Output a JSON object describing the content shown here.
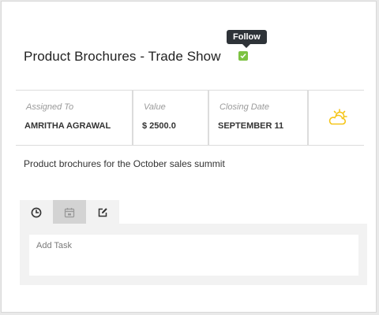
{
  "deal": {
    "title": "Product Brochures - Trade Show",
    "follow_tooltip": "Follow",
    "description": "Product brochures for the October sales summit"
  },
  "stats": {
    "assigned_label": "Assigned To",
    "assigned_value": "AMRITHA AGRAWAL",
    "value_label": "Value",
    "value_value": "$ 2500.0",
    "closing_label": "Closing Date",
    "closing_value": "SEPTEMBER 11",
    "weather_icon": "partly-cloudy-sun-icon"
  },
  "tabs": [
    {
      "icon": "clock-icon",
      "active": false
    },
    {
      "icon": "calendar-icon",
      "active": true
    },
    {
      "icon": "edit-icon",
      "active": false
    }
  ],
  "task": {
    "placeholder": "Add Task",
    "value": ""
  },
  "colors": {
    "follow_green": "#7cc242",
    "weather_yellow": "#f5c518",
    "tooltip_bg": "#2e3338"
  }
}
